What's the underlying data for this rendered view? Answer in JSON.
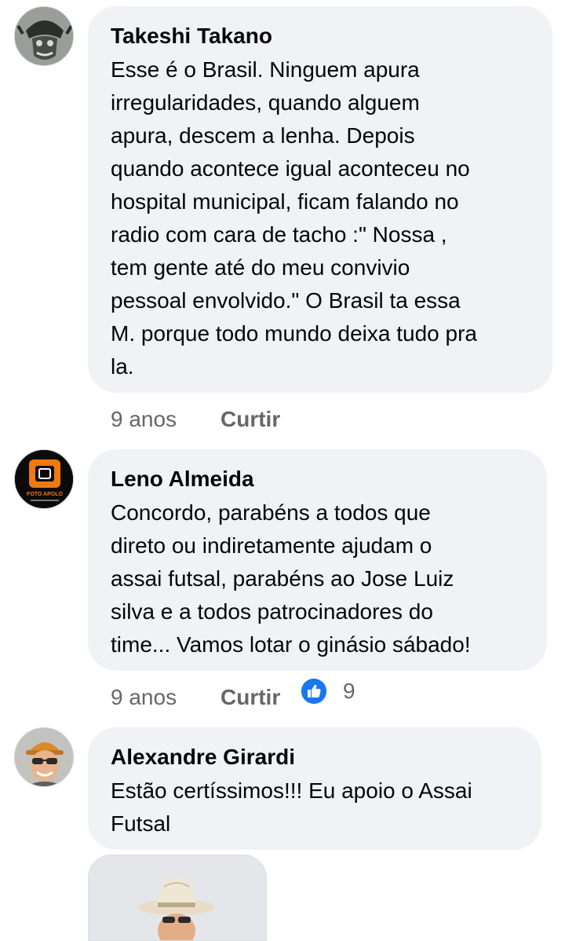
{
  "comments": [
    {
      "author": "Takeshi Takano",
      "text": "Esse é o Brasil. Ninguem apura\nirregularidades, quando alguem\napura, descem a lenha. Depois\nquando acontece igual aconteceu no\nhospital municipal, ficam falando no\nradio com cara de tacho :\" Nossa ,\ntem gente até do meu convivio\npessoal envolvido.\" O Brasil ta essa\nM. porque todo mundo deixa tudo pra\nla.",
      "time": "9 anos",
      "like_label": "Curtir"
    },
    {
      "author": "Leno Almeida",
      "text": "Concordo, parabéns a todos que\ndireto ou indiretamente ajudam o\nassai futsal, parabéns  ao Jose Luiz\nsilva e a todos patrocinadores do\ntime... Vamos lotar o ginásio sábado!",
      "time": "9 anos",
      "like_label": "Curtir",
      "reaction_count": "9",
      "reaction_icon": "like-thumb-icon",
      "avatar_logo_text": "FOTO APOLO"
    },
    {
      "author": "Alexandre Girardi",
      "text": "Estão certíssimos!!! Eu apoio o Assai\nFutsal"
    }
  ],
  "colors": {
    "bubble": "#f0f2f5",
    "meta_text": "#65676b",
    "like_blue": "#1877f2"
  }
}
